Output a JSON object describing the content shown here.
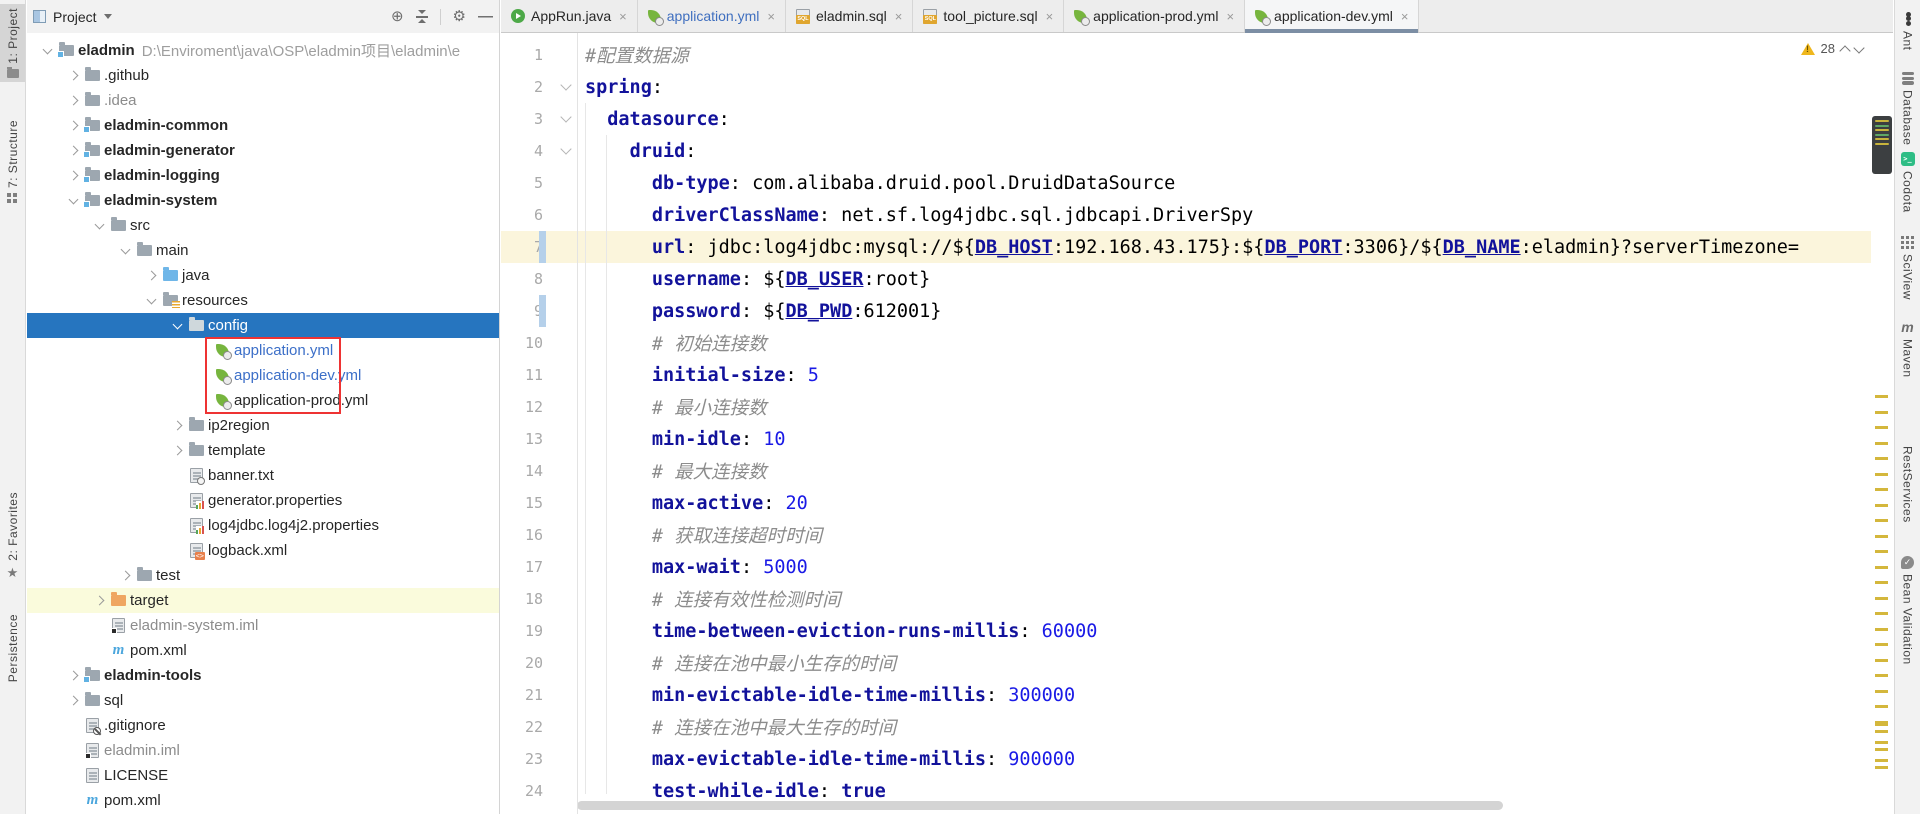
{
  "colors": {
    "selection_blue": "#2675BF",
    "modified_file_blue": "#3C6FC8",
    "warning_yellow": "#EFB71D",
    "red_box": "#EE3333",
    "line_highlight": "#FBF5DC",
    "excluded_row_yellow": "#FAFBDC",
    "yaml_key_navy": "#12129B",
    "spring_green": "#77B53E"
  },
  "left_stripe": {
    "top": [
      {
        "label": "1: Project",
        "icon": "project-tool-icon",
        "active": true
      },
      {
        "label": "7: Structure",
        "icon": "structure-tool-icon",
        "active": false
      }
    ],
    "bottom": [
      {
        "label": "2: Favorites",
        "icon": "star-icon",
        "active": false
      },
      {
        "label": "Persistence",
        "icon": "",
        "active": false
      }
    ]
  },
  "right_stripe": [
    {
      "label": "Ant",
      "icon": "ant-icon"
    },
    {
      "label": "Database",
      "icon": "database-icon"
    },
    {
      "label": "Codota",
      "icon": "codota-icon",
      "codota_glyph": ">_"
    },
    {
      "label": "SciView",
      "icon": "sciview-icon"
    },
    {
      "label": "Maven",
      "icon": "maven-icon",
      "maven_glyph": "m"
    },
    {
      "label": "RestServices",
      "icon": ""
    },
    {
      "label": "Bean Validation",
      "icon": "bean-validation-icon",
      "bean_glyph": "✓"
    }
  ],
  "project_panel": {
    "title": "Project",
    "header_icons": [
      "locate-icon",
      "collapse-all-icon",
      "settings-icon",
      "hide-icon"
    ],
    "tree": [
      {
        "label": "eladmin",
        "path": "D:\\Enviroment\\java\\OSP\\eladmin项目\\eladmin\\e",
        "level": 0,
        "chevron": "down",
        "icon": "module-folder",
        "bold": true
      },
      {
        "label": ".github",
        "level": 1,
        "chevron": "right",
        "icon": "folder"
      },
      {
        "label": ".idea",
        "level": 1,
        "chevron": "right",
        "icon": "folder",
        "muted": true
      },
      {
        "label": "eladmin-common",
        "level": 1,
        "chevron": "right",
        "icon": "module-folder",
        "bold": true
      },
      {
        "label": "eladmin-generator",
        "level": 1,
        "chevron": "right",
        "icon": "module-folder",
        "bold": true
      },
      {
        "label": "eladmin-logging",
        "level": 1,
        "chevron": "right",
        "icon": "module-folder",
        "bold": true
      },
      {
        "label": "eladmin-system",
        "level": 1,
        "chevron": "down",
        "icon": "module-folder",
        "bold": true
      },
      {
        "label": "src",
        "level": 2,
        "chevron": "down",
        "icon": "folder"
      },
      {
        "label": "main",
        "level": 3,
        "chevron": "down",
        "icon": "folder"
      },
      {
        "label": "java",
        "level": 4,
        "chevron": "right",
        "icon": "java-folder"
      },
      {
        "label": "resources",
        "level": 4,
        "chevron": "down",
        "icon": "resources-folder"
      },
      {
        "label": "config",
        "level": 5,
        "chevron": "down",
        "icon": "folder",
        "selected": true
      },
      {
        "label": "application.yml",
        "level": 6,
        "chevron": "none",
        "icon": "spring-file",
        "blue": true,
        "boxed": true
      },
      {
        "label": "application-dev.yml",
        "level": 6,
        "chevron": "none",
        "icon": "spring-file",
        "blue": true,
        "boxed": true
      },
      {
        "label": "application-prod.yml",
        "level": 6,
        "chevron": "none",
        "icon": "spring-file",
        "boxed": true
      },
      {
        "label": "ip2region",
        "level": 5,
        "chevron": "right",
        "icon": "folder"
      },
      {
        "label": "template",
        "level": 5,
        "chevron": "right",
        "icon": "folder"
      },
      {
        "label": "banner.txt",
        "level": 5,
        "chevron": "none",
        "icon": "text-file"
      },
      {
        "label": "generator.properties",
        "level": 5,
        "chevron": "none",
        "icon": "properties-file"
      },
      {
        "label": "log4jdbc.log4j2.properties",
        "level": 5,
        "chevron": "none",
        "icon": "properties-file"
      },
      {
        "label": "logback.xml",
        "level": 5,
        "chevron": "none",
        "icon": "xml-file"
      },
      {
        "label": "test",
        "level": 3,
        "chevron": "right",
        "icon": "folder"
      },
      {
        "label": "target",
        "level": 2,
        "chevron": "right",
        "icon": "excluded-folder",
        "rowHighlight": true
      },
      {
        "label": "eladmin-system.iml",
        "level": 2,
        "chevron": "none",
        "icon": "iml-file",
        "muted": true
      },
      {
        "label": "pom.xml",
        "level": 2,
        "chevron": "none",
        "icon": "maven-file"
      },
      {
        "label": "eladmin-tools",
        "level": 1,
        "chevron": "right",
        "icon": "module-folder",
        "bold": true
      },
      {
        "label": "sql",
        "level": 1,
        "chevron": "right",
        "icon": "folder"
      },
      {
        "label": ".gitignore",
        "level": 1,
        "chevron": "none",
        "icon": "ignore-file"
      },
      {
        "label": "eladmin.iml",
        "level": 1,
        "chevron": "none",
        "icon": "iml-file",
        "muted": true
      },
      {
        "label": "LICENSE",
        "level": 1,
        "chevron": "none",
        "icon": "license-file"
      },
      {
        "label": "pom.xml",
        "level": 1,
        "chevron": "none",
        "icon": "maven-file"
      }
    ],
    "red_box_rows": {
      "start": 12,
      "end": 14
    }
  },
  "tabs": [
    {
      "label": "AppRun.java",
      "icon": "spring-run-icon"
    },
    {
      "label": "application.yml",
      "icon": "spring-leaf-icon",
      "blue": true
    },
    {
      "label": "eladmin.sql",
      "icon": "sql-file-icon"
    },
    {
      "label": "tool_picture.sql",
      "icon": "sql-file-icon"
    },
    {
      "label": "application-prod.yml",
      "icon": "spring-leaf-icon"
    },
    {
      "label": "application-dev.yml",
      "icon": "spring-leaf-icon",
      "active": true
    }
  ],
  "editor": {
    "warning_count": "28",
    "fold_lines": [
      2,
      3,
      4
    ],
    "changed_lines": [
      7,
      9
    ],
    "highlighted_line": 7,
    "lines": [
      {
        "n": 1,
        "tokens": [
          [
            "c",
            "#配置数据源"
          ]
        ]
      },
      {
        "n": 2,
        "tokens": [
          [
            "k",
            "spring"
          ],
          [
            "p",
            ":"
          ]
        ]
      },
      {
        "n": 3,
        "tokens": [
          [
            "p",
            "  "
          ],
          [
            "k",
            "datasource"
          ],
          [
            "p",
            ":"
          ]
        ]
      },
      {
        "n": 4,
        "tokens": [
          [
            "p",
            "    "
          ],
          [
            "k",
            "druid"
          ],
          [
            "p",
            ":"
          ]
        ]
      },
      {
        "n": 5,
        "tokens": [
          [
            "p",
            "      "
          ],
          [
            "k",
            "db-type"
          ],
          [
            "p",
            ": com.alibaba.druid.pool.DruidDataSource"
          ]
        ]
      },
      {
        "n": 6,
        "tokens": [
          [
            "p",
            "      "
          ],
          [
            "k",
            "driverClassName"
          ],
          [
            "p",
            ": net.sf.log4jdbc.sql.jdbcapi.DriverSpy"
          ]
        ]
      },
      {
        "n": 7,
        "tokens": [
          [
            "p",
            "      "
          ],
          [
            "k",
            "url"
          ],
          [
            "p",
            ": jdbc:log4jdbc:mysql://${"
          ],
          [
            "v",
            "DB_HOST"
          ],
          [
            "p",
            ":192.168.43.175}:${"
          ],
          [
            "v",
            "DB_PORT"
          ],
          [
            "p",
            ":3306}/${"
          ],
          [
            "v",
            "DB_NAME"
          ],
          [
            "p",
            ":eladmin}?serverTimezone="
          ]
        ]
      },
      {
        "n": 8,
        "tokens": [
          [
            "p",
            "      "
          ],
          [
            "k",
            "username"
          ],
          [
            "p",
            ": ${"
          ],
          [
            "v",
            "DB_USER"
          ],
          [
            "p",
            ":root}"
          ]
        ]
      },
      {
        "n": 9,
        "tokens": [
          [
            "p",
            "      "
          ],
          [
            "k",
            "password"
          ],
          [
            "p",
            ": ${"
          ],
          [
            "v",
            "DB_PWD"
          ],
          [
            "p",
            ":612001}"
          ]
        ]
      },
      {
        "n": 10,
        "tokens": [
          [
            "p",
            "      "
          ],
          [
            "c",
            "# 初始连接数"
          ]
        ]
      },
      {
        "n": 11,
        "tokens": [
          [
            "p",
            "      "
          ],
          [
            "k",
            "initial-size"
          ],
          [
            "p",
            ": "
          ],
          [
            "n",
            "5"
          ]
        ]
      },
      {
        "n": 12,
        "tokens": [
          [
            "p",
            "      "
          ],
          [
            "c",
            "# 最小连接数"
          ]
        ]
      },
      {
        "n": 13,
        "tokens": [
          [
            "p",
            "      "
          ],
          [
            "k",
            "min-idle"
          ],
          [
            "p",
            ": "
          ],
          [
            "n",
            "10"
          ]
        ]
      },
      {
        "n": 14,
        "tokens": [
          [
            "p",
            "      "
          ],
          [
            "c",
            "# 最大连接数"
          ]
        ]
      },
      {
        "n": 15,
        "tokens": [
          [
            "p",
            "      "
          ],
          [
            "k",
            "max-active"
          ],
          [
            "p",
            ": "
          ],
          [
            "n",
            "20"
          ]
        ]
      },
      {
        "n": 16,
        "tokens": [
          [
            "p",
            "      "
          ],
          [
            "c",
            "# 获取连接超时时间"
          ]
        ]
      },
      {
        "n": 17,
        "tokens": [
          [
            "p",
            "      "
          ],
          [
            "k",
            "max-wait"
          ],
          [
            "p",
            ": "
          ],
          [
            "n",
            "5000"
          ]
        ]
      },
      {
        "n": 18,
        "tokens": [
          [
            "p",
            "      "
          ],
          [
            "c",
            "# 连接有效性检测时间"
          ]
        ]
      },
      {
        "n": 19,
        "tokens": [
          [
            "p",
            "      "
          ],
          [
            "k",
            "time-between-eviction-runs-millis"
          ],
          [
            "p",
            ": "
          ],
          [
            "n",
            "60000"
          ]
        ]
      },
      {
        "n": 20,
        "tokens": [
          [
            "p",
            "      "
          ],
          [
            "c",
            "# 连接在池中最小生存的时间"
          ]
        ]
      },
      {
        "n": 21,
        "tokens": [
          [
            "p",
            "      "
          ],
          [
            "k",
            "min-evictable-idle-time-millis"
          ],
          [
            "p",
            ": "
          ],
          [
            "n",
            "300000"
          ]
        ]
      },
      {
        "n": 22,
        "tokens": [
          [
            "p",
            "      "
          ],
          [
            "c",
            "# 连接在池中最大生存的时间"
          ]
        ]
      },
      {
        "n": 23,
        "tokens": [
          [
            "p",
            "      "
          ],
          [
            "k",
            "max-evictable-idle-time-millis"
          ],
          [
            "p",
            ": "
          ],
          [
            "n",
            "900000"
          ]
        ]
      },
      {
        "n": 24,
        "tokens": [
          [
            "p",
            "      "
          ],
          [
            "k",
            "test-while-idle"
          ],
          [
            "p",
            ": "
          ],
          [
            "kw",
            "true"
          ]
        ]
      }
    ]
  }
}
